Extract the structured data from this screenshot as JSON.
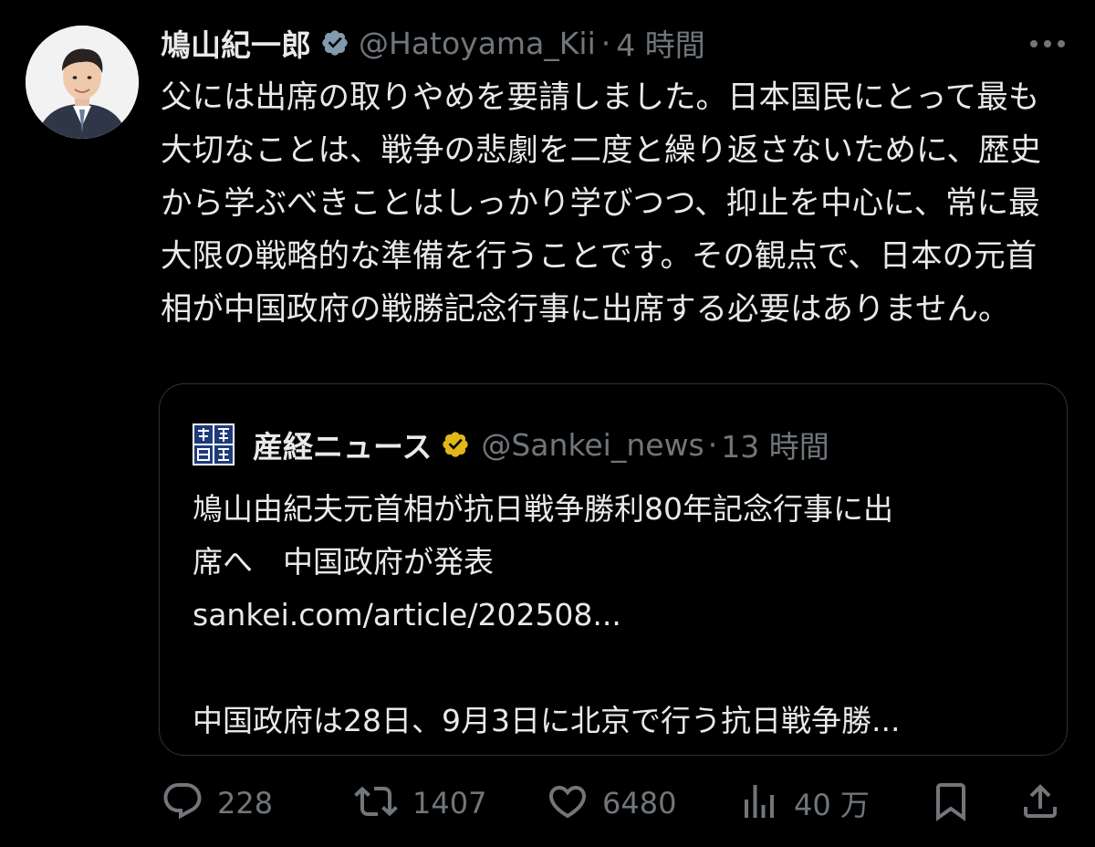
{
  "tweet": {
    "author_name": "鳩山紀一郎",
    "handle": "@Hatoyama_Kii",
    "separator": "·",
    "time": "4 時間",
    "verified_color": "#829aab",
    "text": "父には出席の取りやめを要請しました。日本国民にとって最も大切なことは、戦争の悲劇を二度と繰り返さないために、歴史から学ぶべきことはしっかり学びつつ、抑止を中心に、常に最大限の戦略的な準備を行うことです。その観点で、日本の元首相が中国政府の戦勝記念行事に出席する必要はありません。"
  },
  "quote": {
    "author_name": "産経ニュース",
    "handle": "@Sankei_news",
    "separator": "·",
    "time": "13 時間",
    "verified_color": "#e2b719",
    "lines": [
      "鳩山由紀夫元首相が抗日戦争勝利80年記念行事に出",
      "席へ　中国政府が発表",
      "sankei.com/article/202508...",
      "",
      "中国政府は28日、9月3日に北京で行う抗日戦争勝..."
    ]
  },
  "actions": {
    "reply_count": "228",
    "repost_count": "1407",
    "like_count": "6480",
    "views_count": "40 万"
  },
  "icons": {
    "reply": "reply-icon",
    "repost": "repost-icon",
    "like": "like-icon",
    "views": "views-icon",
    "bookmark": "bookmark-icon",
    "share": "share-icon",
    "more": "more-icon",
    "verified": "verified-badge-icon"
  },
  "colors": {
    "background": "#000000",
    "text": "#e7e9ea",
    "secondary": "#71767b",
    "border": "#2f3336"
  }
}
